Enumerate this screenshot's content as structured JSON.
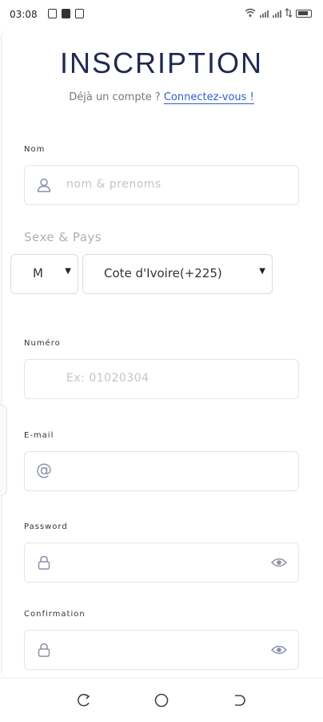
{
  "status_bar": {
    "time": "03:08"
  },
  "page": {
    "title": "INSCRIPTION",
    "subtitle_text": "Déjà un compte ?",
    "login_link": "Connectez-vous !"
  },
  "form": {
    "nom": {
      "label": "Nom",
      "placeholder": "nom & prenoms",
      "icon": "user-icon"
    },
    "sexe_pays": {
      "label": "Sexe & Pays",
      "sexe_value": "M",
      "pays_value": "Cote d'Ivoire(+225)"
    },
    "numero": {
      "label": "Numéro",
      "placeholder": "Ex: 01020304"
    },
    "email": {
      "label": "E-mail",
      "icon": "at-icon"
    },
    "password": {
      "label": "Password",
      "icon": "lock-icon",
      "toggle_icon": "eye-icon"
    },
    "confirmation": {
      "label": "Confirmation",
      "icon": "lock-icon",
      "toggle_icon": "eye-icon"
    }
  },
  "nav_bar": {
    "icons": [
      "recent-apps-icon",
      "home-icon",
      "back-icon"
    ]
  },
  "colors": {
    "title": "#1f2a52",
    "link": "#2c5dc8",
    "border": "#e2e4ee"
  }
}
